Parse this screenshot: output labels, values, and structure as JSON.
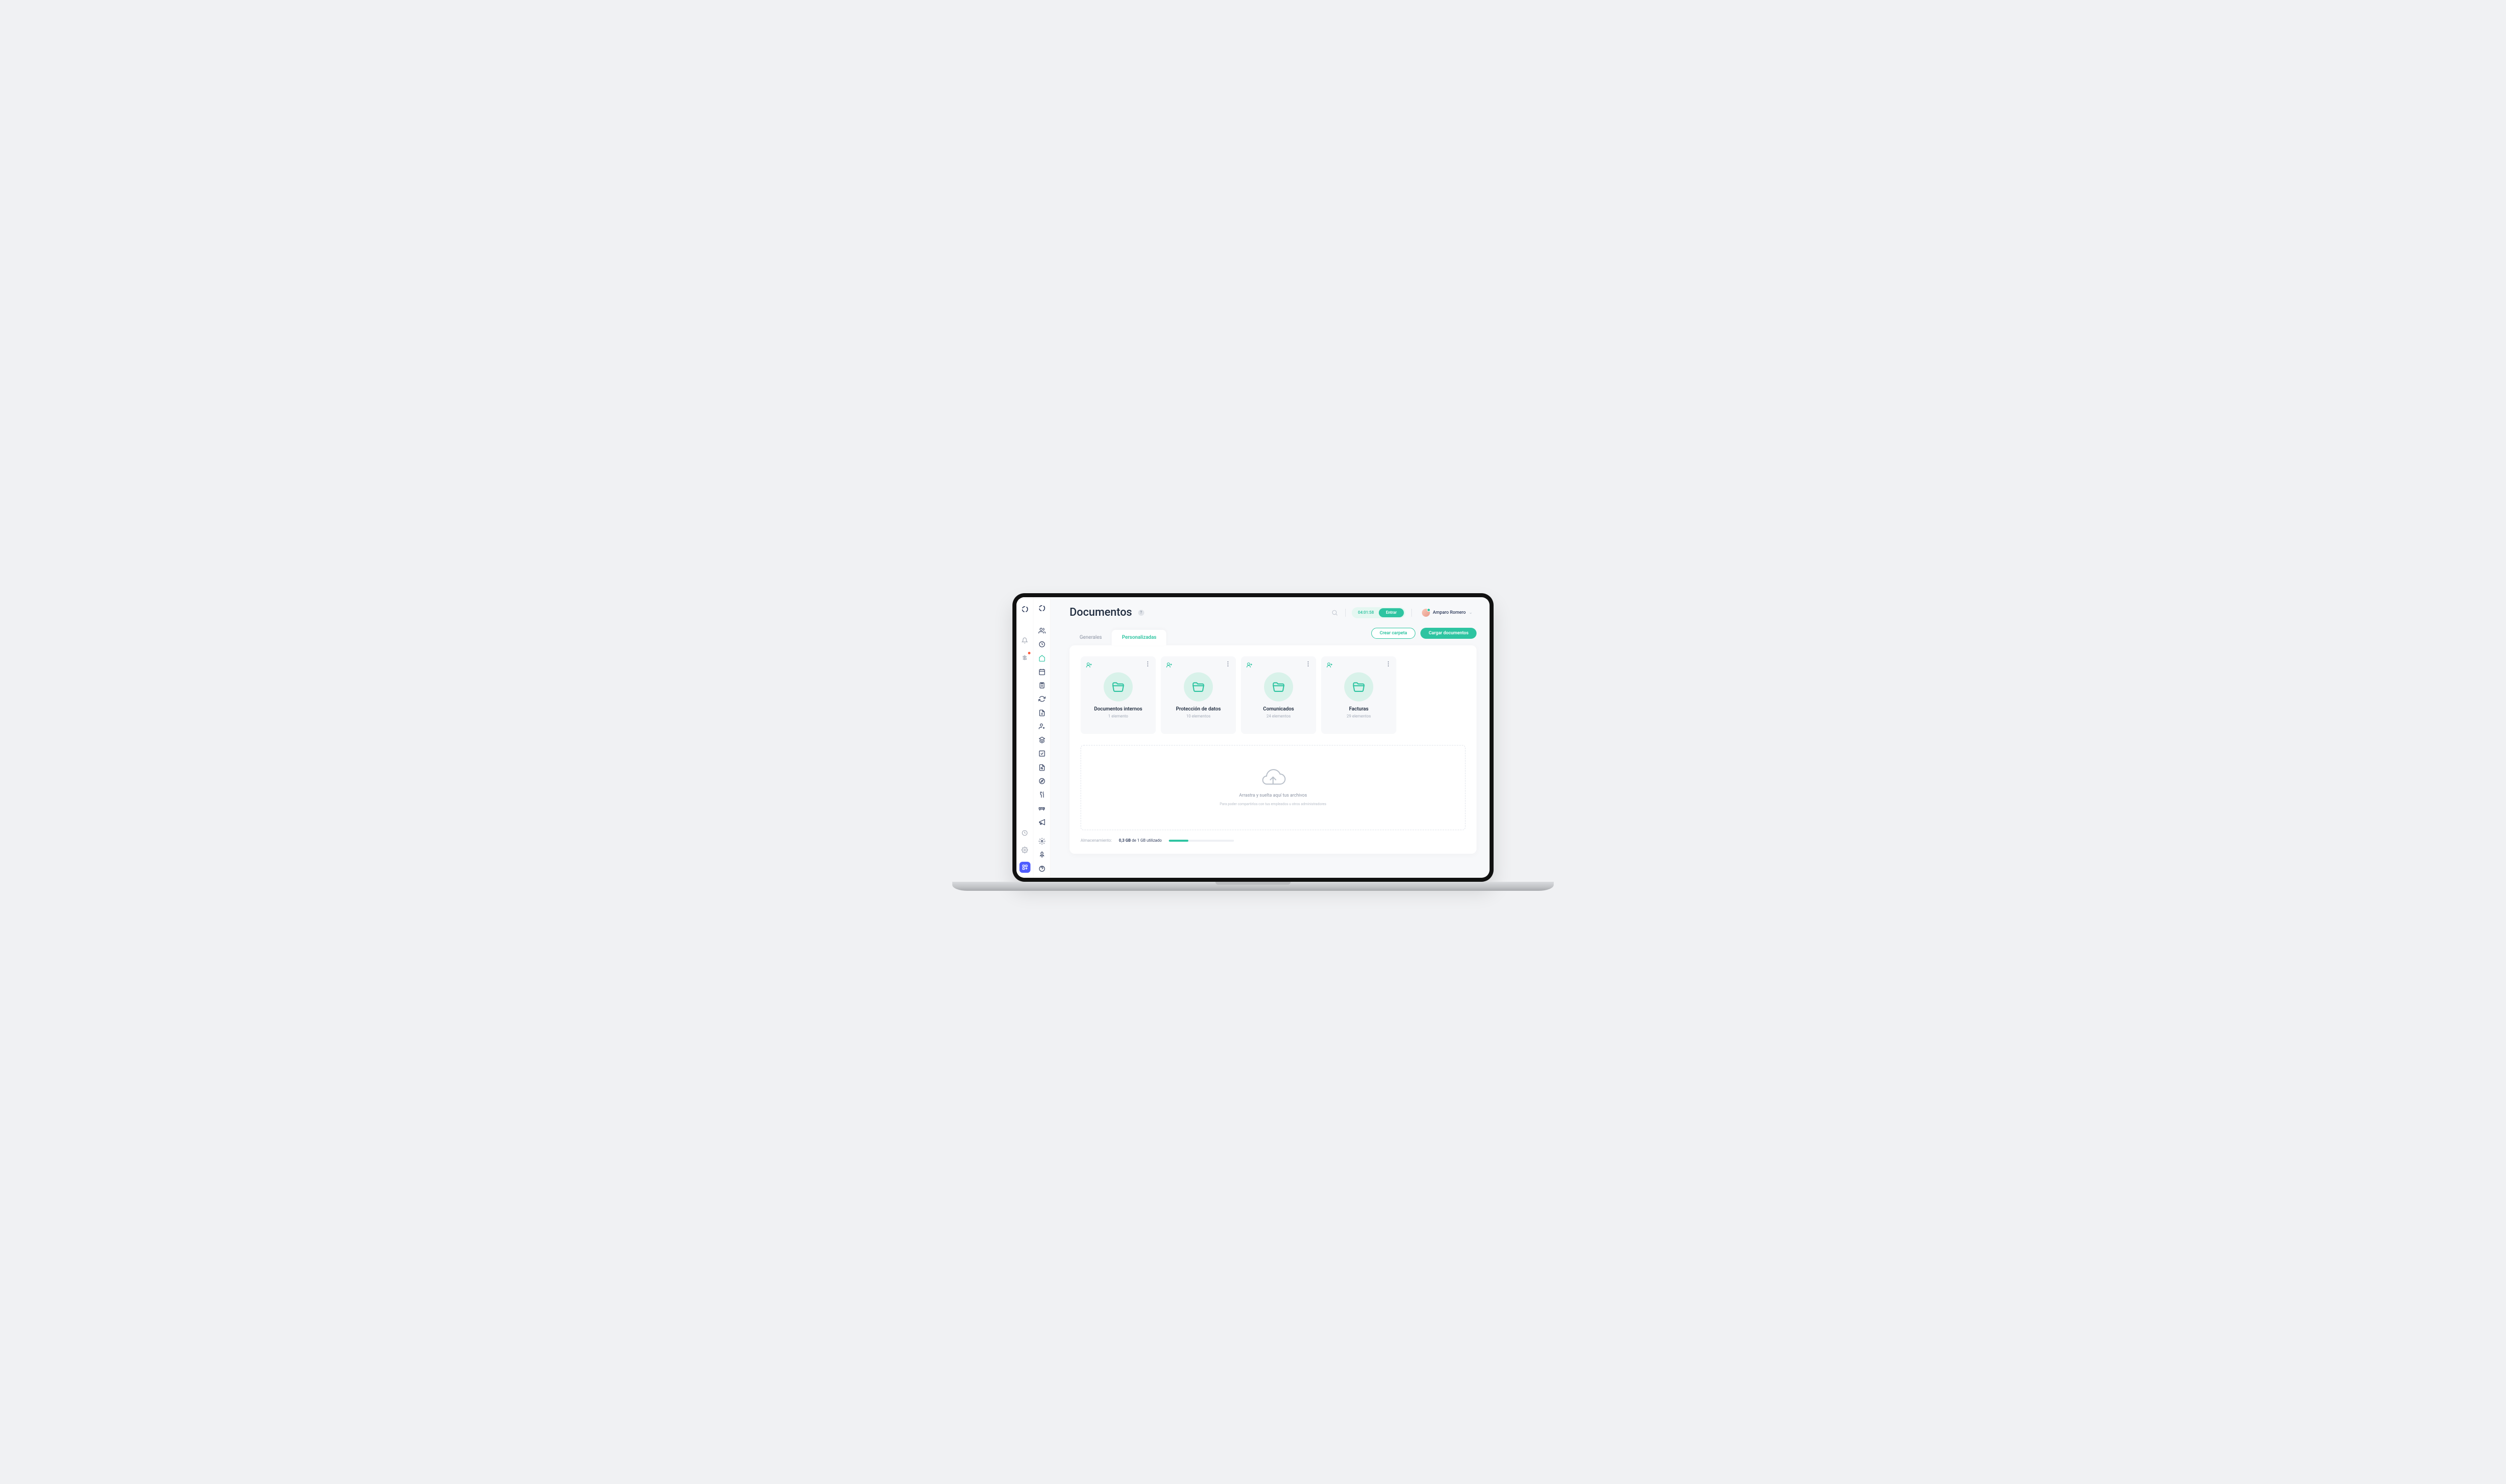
{
  "page": {
    "title": "Documentos"
  },
  "header": {
    "timer": "04:01:58",
    "timer_action": "Entrar",
    "user_name": "Amparo Romero"
  },
  "actions": {
    "create_folder": "Crear carpeta",
    "upload": "Cargar documentos"
  },
  "tabs": [
    {
      "label": "Generales",
      "active": false
    },
    {
      "label": "Personalizadas",
      "active": true
    }
  ],
  "folders": [
    {
      "title": "Documentos internos",
      "sub": "1 elemento"
    },
    {
      "title": "Protección de datos",
      "sub": "10 elementos"
    },
    {
      "title": "Comunicados",
      "sub": "24 elementos"
    },
    {
      "title": "Facturas",
      "sub": "29 elementos"
    }
  ],
  "dropzone": {
    "title": "Arrastra y suelta aquí tus archivos",
    "sub": "Para poder compartirlos con tus empleados u otros administradores"
  },
  "storage": {
    "label": "Almacenamiento:",
    "used_bold": "0,3 GB",
    "used_suffix": " de 1 GB utilizado",
    "percent": 30
  }
}
